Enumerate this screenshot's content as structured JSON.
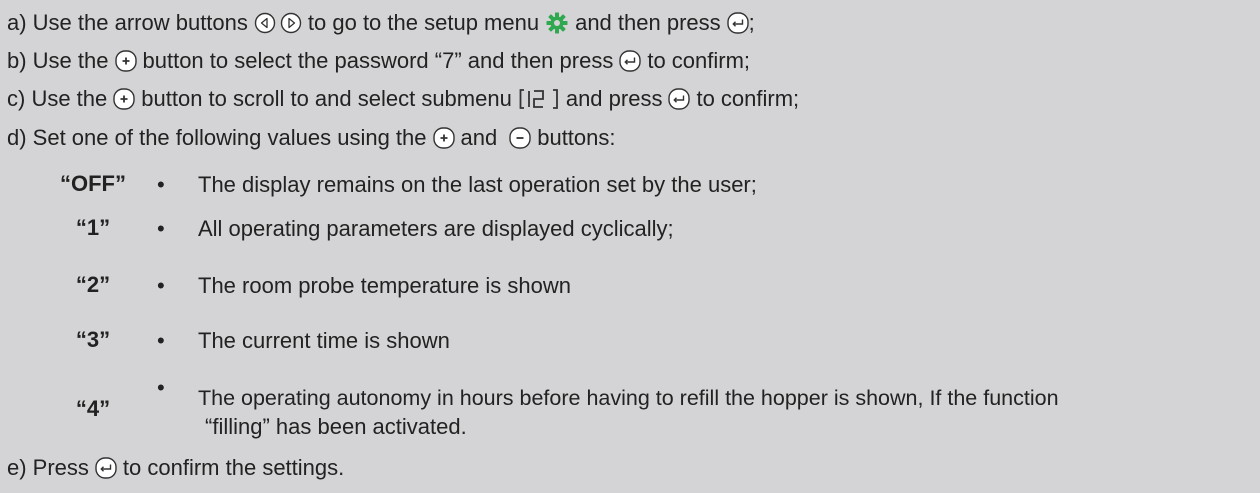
{
  "steps": {
    "a": {
      "prefix": "a) Use the arrow buttons",
      "mid": "to go to the setup menu",
      "end": "and then press",
      "tail": ";",
      "icons": [
        "left-arrow-button-icon",
        "right-arrow-button-icon",
        "gear-icon",
        "enter-button-icon"
      ]
    },
    "b": {
      "prefix": "b) Use the",
      "mid": "button to select the password “7” and then press",
      "end": "to confirm;",
      "icons": [
        "plus-button-icon",
        "enter-button-icon"
      ]
    },
    "c": {
      "prefix": "c) Use the",
      "mid": "button to scroll to and select submenu",
      "submenu_code": "[12]",
      "end": "and press",
      "tail": "to confirm;",
      "icons": [
        "plus-button-icon",
        "enter-button-icon"
      ]
    },
    "d": {
      "prefix": "d) Set one of the following values using the",
      "mid": "and",
      "end": "buttons:",
      "icons": [
        "plus-button-icon",
        "minus-button-icon"
      ]
    },
    "e": {
      "prefix": "e) Press",
      "end": "to confirm the settings.",
      "icons": [
        "enter-button-icon"
      ]
    }
  },
  "options": [
    {
      "code": "“OFF”",
      "bullet": "•",
      "text": "The display remains on the last operation set by the user;"
    },
    {
      "code": "“1”",
      "bullet": "•",
      "text": "All operating parameters are displayed cyclically;"
    },
    {
      "code": "“2”",
      "bullet": "•",
      "text": "The room probe temperature is shown"
    },
    {
      "code": "“3”",
      "bullet": "•",
      "text": "The current time is shown"
    },
    {
      "code": "“4”",
      "bullet": "•",
      "text": "The operating autonomy in hours before having to refill the hopper is shown, If the function",
      "text_line2": "“filling” has been activated."
    }
  ],
  "colors": {
    "gear": "#2fa84f",
    "text": "#222222",
    "background": "#d4d4d6"
  }
}
